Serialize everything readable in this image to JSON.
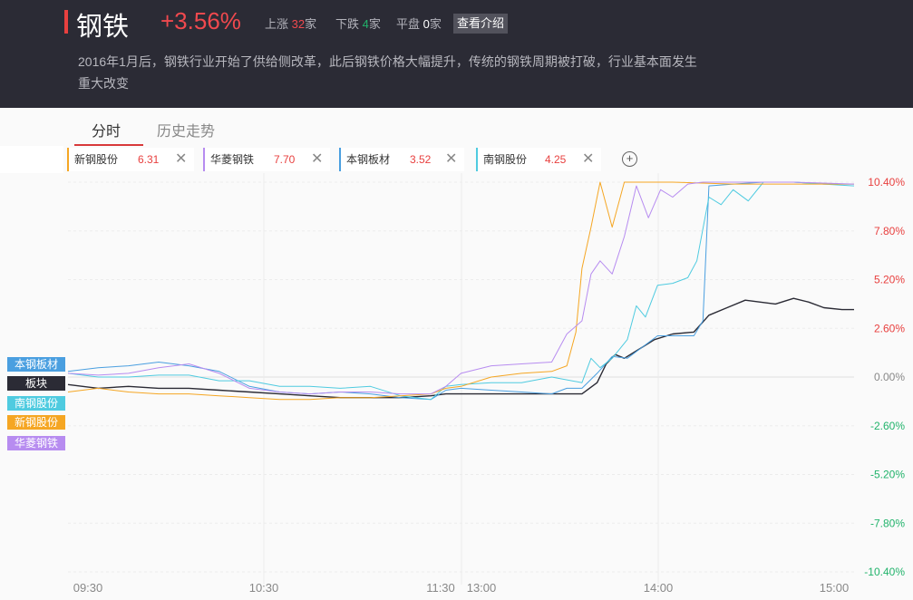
{
  "header": {
    "title": "钢铁",
    "change": "+3.56%",
    "up_label": "上涨",
    "up_count": "32",
    "down_label": "下跌",
    "down_count": "4",
    "flat_label": "平盘",
    "flat_count": "0",
    "unit": "家",
    "intro_button": "查看介绍",
    "description": "2016年1月后，钢铁行业开始了供给侧改革，此后钢铁价格大幅提升，传统的钢铁周期被打破，行业基本面发生重大改变"
  },
  "tabs": [
    {
      "label": "分时"
    },
    {
      "label": "历史走势"
    }
  ],
  "stocks": [
    {
      "name": "新钢股份",
      "price": "6.31",
      "color": "#f5a623"
    },
    {
      "name": "华菱钢铁",
      "price": "7.70",
      "color": "#b78cf0"
    },
    {
      "name": "本钢板材",
      "price": "3.52",
      "color": "#4a9fe0"
    },
    {
      "name": "南钢股份",
      "price": "4.25",
      "color": "#4fcbe0"
    }
  ],
  "legend": [
    {
      "label": "本钢板材",
      "color": "#4a9fe0"
    },
    {
      "label": "板块",
      "color": "#2b2b35"
    },
    {
      "label": "南钢股份",
      "color": "#4fcbe0"
    },
    {
      "label": "新钢股份",
      "color": "#f5a623"
    },
    {
      "label": "华菱钢铁",
      "color": "#b78cf0"
    }
  ],
  "chart_data": {
    "type": "line",
    "x_ticks": [
      "09:30",
      "10:30",
      "11:30",
      "13:00",
      "14:00",
      "15:00"
    ],
    "x_tick_minutes": [
      0,
      60,
      120,
      120,
      180,
      240
    ],
    "y_ticks": [
      "10.40%",
      "7.80%",
      "5.20%",
      "2.60%",
      "0.00%",
      "-2.60%",
      "-5.20%",
      "-7.80%",
      "-10.40%"
    ],
    "ylim": [
      -10.4,
      10.4
    ],
    "xlim": [
      0,
      240
    ],
    "colors": {
      "up": "#e8403f",
      "down": "#21b36b",
      "zero": "#888888"
    },
    "series": [
      {
        "name": "板块",
        "color": "#2b2b35",
        "width": 1.4,
        "points": [
          [
            0,
            -0.4
          ],
          [
            10,
            -0.6
          ],
          [
            20,
            -0.5
          ],
          [
            30,
            -0.6
          ],
          [
            40,
            -0.6
          ],
          [
            50,
            -0.7
          ],
          [
            60,
            -0.8
          ],
          [
            70,
            -0.9
          ],
          [
            80,
            -1.0
          ],
          [
            90,
            -1.1
          ],
          [
            100,
            -1.1
          ],
          [
            110,
            -1.1
          ],
          [
            120,
            -1.0
          ],
          [
            125,
            -0.9
          ],
          [
            130,
            -0.9
          ],
          [
            140,
            -0.9
          ],
          [
            150,
            -0.9
          ],
          [
            160,
            -0.9
          ],
          [
            170,
            -0.9
          ],
          [
            175,
            -0.3
          ],
          [
            178,
            0.7
          ],
          [
            181,
            1.2
          ],
          [
            184,
            1.0
          ],
          [
            188,
            1.4
          ],
          [
            194,
            2.0
          ],
          [
            200,
            2.3
          ],
          [
            207,
            2.4
          ],
          [
            212,
            3.3
          ],
          [
            218,
            3.7
          ],
          [
            224,
            4.1
          ],
          [
            229,
            4.0
          ],
          [
            234,
            3.9
          ],
          [
            240,
            4.2
          ],
          [
            245,
            4.0
          ],
          [
            250,
            3.7
          ],
          [
            256,
            3.6
          ],
          [
            260,
            3.6
          ]
        ]
      },
      {
        "name": "本钢板材",
        "color": "#4a9fe0",
        "width": 1,
        "points": [
          [
            0,
            0.3
          ],
          [
            10,
            0.5
          ],
          [
            20,
            0.6
          ],
          [
            30,
            0.8
          ],
          [
            40,
            0.6
          ],
          [
            50,
            0.3
          ],
          [
            60,
            -0.5
          ],
          [
            70,
            -0.8
          ],
          [
            80,
            -0.9
          ],
          [
            90,
            -0.8
          ],
          [
            100,
            -0.9
          ],
          [
            110,
            -1.1
          ],
          [
            120,
            -1.2
          ],
          [
            125,
            -0.7
          ],
          [
            130,
            -0.6
          ],
          [
            140,
            -0.7
          ],
          [
            150,
            -0.8
          ],
          [
            160,
            -0.9
          ],
          [
            165,
            -0.6
          ],
          [
            170,
            -0.6
          ],
          [
            175,
            0.2
          ],
          [
            180,
            1.1
          ],
          [
            185,
            1.0
          ],
          [
            190,
            1.6
          ],
          [
            195,
            2.2
          ],
          [
            200,
            2.2
          ],
          [
            207,
            2.2
          ],
          [
            210,
            3.0
          ],
          [
            212,
            10.2
          ],
          [
            220,
            10.3
          ],
          [
            230,
            10.4
          ],
          [
            240,
            10.4
          ],
          [
            250,
            10.3
          ],
          [
            260,
            10.3
          ]
        ]
      },
      {
        "name": "南钢股份",
        "color": "#4fcbe0",
        "width": 1,
        "points": [
          [
            0,
            0.2
          ],
          [
            10,
            0.0
          ],
          [
            20,
            0.0
          ],
          [
            30,
            0.1
          ],
          [
            40,
            0.1
          ],
          [
            50,
            -0.2
          ],
          [
            60,
            -0.2
          ],
          [
            70,
            -0.5
          ],
          [
            80,
            -0.5
          ],
          [
            90,
            -0.6
          ],
          [
            100,
            -0.5
          ],
          [
            110,
            -1.0
          ],
          [
            120,
            -1.2
          ],
          [
            125,
            -0.5
          ],
          [
            130,
            -0.4
          ],
          [
            140,
            -0.3
          ],
          [
            150,
            -0.3
          ],
          [
            160,
            0.0
          ],
          [
            170,
            -0.3
          ],
          [
            173,
            1.0
          ],
          [
            176,
            0.5
          ],
          [
            180,
            1.0
          ],
          [
            185,
            2.0
          ],
          [
            188,
            3.8
          ],
          [
            191,
            3.2
          ],
          [
            195,
            4.9
          ],
          [
            200,
            5.0
          ],
          [
            205,
            5.3
          ],
          [
            208,
            6.2
          ],
          [
            212,
            9.6
          ],
          [
            216,
            9.2
          ],
          [
            220,
            10.0
          ],
          [
            225,
            9.4
          ],
          [
            230,
            10.4
          ],
          [
            240,
            10.4
          ],
          [
            250,
            10.3
          ],
          [
            260,
            10.2
          ]
        ]
      },
      {
        "name": "新钢股份",
        "color": "#f5a623",
        "width": 1,
        "points": [
          [
            0,
            -0.8
          ],
          [
            10,
            -0.6
          ],
          [
            20,
            -0.8
          ],
          [
            30,
            -0.9
          ],
          [
            40,
            -0.9
          ],
          [
            50,
            -1.0
          ],
          [
            60,
            -1.1
          ],
          [
            70,
            -1.2
          ],
          [
            80,
            -1.2
          ],
          [
            90,
            -1.1
          ],
          [
            100,
            -1.1
          ],
          [
            110,
            -1.0
          ],
          [
            120,
            -0.9
          ],
          [
            125,
            -0.6
          ],
          [
            130,
            -0.5
          ],
          [
            140,
            0.0
          ],
          [
            150,
            0.2
          ],
          [
            160,
            0.3
          ],
          [
            165,
            0.6
          ],
          [
            168,
            2.4
          ],
          [
            170,
            5.8
          ],
          [
            173,
            8.0
          ],
          [
            176,
            10.4
          ],
          [
            180,
            8.0
          ],
          [
            184,
            10.4
          ],
          [
            190,
            10.4
          ],
          [
            200,
            10.4
          ],
          [
            220,
            10.3
          ],
          [
            240,
            10.3
          ],
          [
            260,
            10.3
          ]
        ]
      },
      {
        "name": "华菱钢铁",
        "color": "#b78cf0",
        "width": 1,
        "points": [
          [
            0,
            0.2
          ],
          [
            10,
            0.1
          ],
          [
            20,
            0.2
          ],
          [
            30,
            0.5
          ],
          [
            40,
            0.7
          ],
          [
            50,
            0.2
          ],
          [
            60,
            -0.6
          ],
          [
            70,
            -0.8
          ],
          [
            80,
            -0.9
          ],
          [
            90,
            -0.8
          ],
          [
            100,
            -0.8
          ],
          [
            110,
            -0.9
          ],
          [
            120,
            -0.9
          ],
          [
            125,
            -0.5
          ],
          [
            130,
            0.2
          ],
          [
            140,
            0.6
          ],
          [
            150,
            0.7
          ],
          [
            160,
            0.8
          ],
          [
            165,
            2.3
          ],
          [
            170,
            3.0
          ],
          [
            173,
            5.5
          ],
          [
            176,
            6.2
          ],
          [
            180,
            5.5
          ],
          [
            184,
            7.5
          ],
          [
            188,
            10.2
          ],
          [
            192,
            8.5
          ],
          [
            196,
            10.0
          ],
          [
            200,
            9.6
          ],
          [
            205,
            10.3
          ],
          [
            210,
            10.4
          ],
          [
            220,
            10.4
          ],
          [
            240,
            10.4
          ],
          [
            260,
            10.3
          ]
        ]
      }
    ]
  }
}
